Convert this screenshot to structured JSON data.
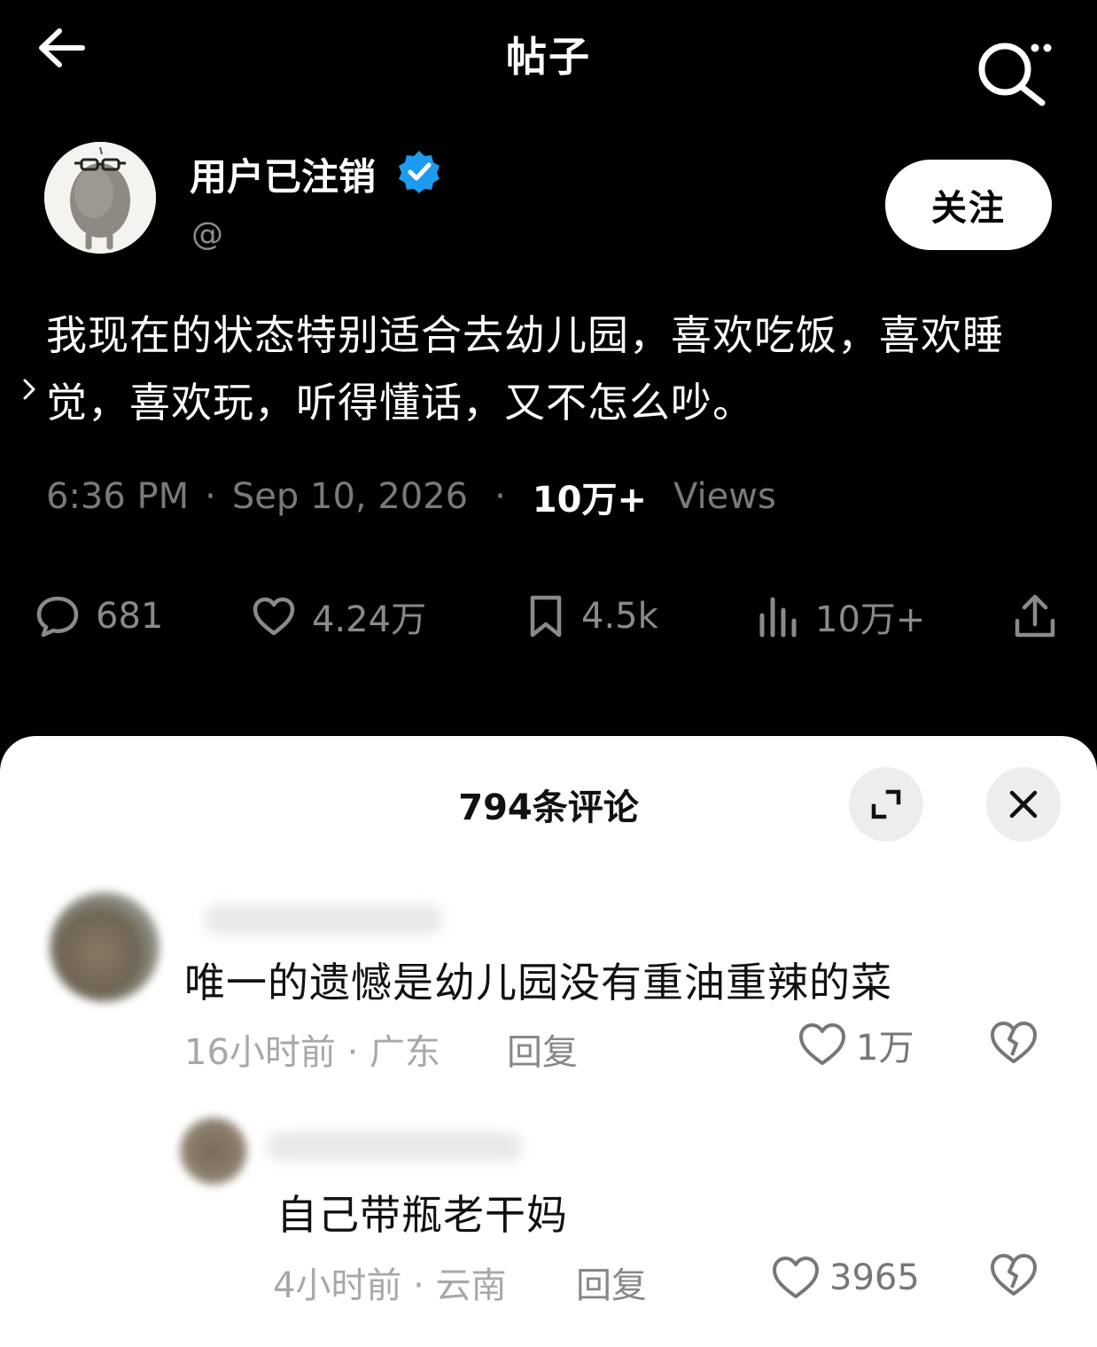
{
  "header": {
    "title": "帖子"
  },
  "author": {
    "name": "用户已注销",
    "handle": "@",
    "follow_label": "关注"
  },
  "post": {
    "text": "我现在的状态特别适合去幼儿园，喜欢吃饭，喜欢睡觉，喜欢玩，听得懂话，又不怎么吵。",
    "time": "6:36 PM",
    "date": "Sep 10, 2026",
    "views_count": "10万+",
    "views_label": "Views"
  },
  "stats": {
    "comments": "681",
    "likes": "4.24万",
    "bookmarks": "4.5k",
    "views": "10万+"
  },
  "comments_panel": {
    "title": "794条评论",
    "items": [
      {
        "text": "唯一的遗憾是幼儿园没有重油重辣的菜",
        "meta": "16小时前 · 广东",
        "reply_label": "回复",
        "likes": "1万"
      },
      {
        "text": "自己带瓶老干妈",
        "meta": "4小时前 · 云南",
        "reply_label": "回复",
        "likes": "3965"
      }
    ]
  },
  "colors": {
    "background": "#000000",
    "sheet": "#ffffff",
    "verified": "#1d9bf0",
    "muted_text": "#7a7a7a"
  },
  "icons": {
    "back": "arrow-left-icon",
    "search": "search-icon",
    "verified": "verified-badge-icon",
    "comment": "comment-icon",
    "like": "heart-icon",
    "bookmark": "bookmark-icon",
    "views": "bar-chart-icon",
    "share": "share-icon",
    "expand": "expand-icon",
    "close": "close-icon",
    "dislike": "broken-heart-icon"
  }
}
